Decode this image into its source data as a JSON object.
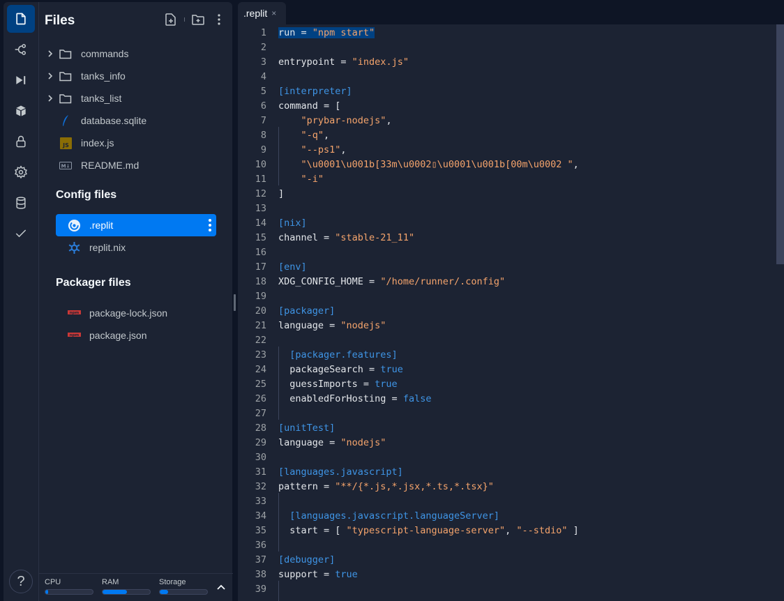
{
  "activity_bar": {
    "items": [
      {
        "name": "files",
        "icon": "file-icon",
        "active": true
      },
      {
        "name": "git",
        "icon": "git-branch-icon"
      },
      {
        "name": "debugger",
        "icon": "step-icon"
      },
      {
        "name": "packages",
        "icon": "package-cube-icon"
      },
      {
        "name": "secrets",
        "icon": "lock-icon"
      },
      {
        "name": "settings",
        "icon": "gear-icon"
      },
      {
        "name": "database",
        "icon": "database-icon"
      },
      {
        "name": "unit-tests",
        "icon": "check-icon"
      }
    ],
    "help_label": "?"
  },
  "sidebar": {
    "title": "Files",
    "actions": [
      "new-file-icon",
      "new-folder-icon",
      "more-options-icon"
    ],
    "tree": [
      {
        "name": "commands",
        "type": "folder"
      },
      {
        "name": "tanks_info",
        "type": "folder"
      },
      {
        "name": "tanks_list",
        "type": "folder"
      },
      {
        "name": "database.sqlite",
        "type": "sqlite"
      },
      {
        "name": "index.js",
        "type": "js"
      },
      {
        "name": "README.md",
        "type": "markdown"
      }
    ],
    "config_section": {
      "title": "Config files",
      "items": [
        {
          "name": ".replit",
          "selected": true
        },
        {
          "name": "replit.nix",
          "selected": false
        }
      ]
    },
    "packager_section": {
      "title": "Packager files",
      "items": [
        {
          "name": "package-lock.json"
        },
        {
          "name": "package.json"
        }
      ]
    },
    "resources": [
      {
        "label": "CPU",
        "usage": 0.04
      },
      {
        "label": "RAM",
        "usage": 0.52
      },
      {
        "label": "Storage",
        "usage": 0.17
      }
    ]
  },
  "editor": {
    "tab": {
      "label": ".replit",
      "close": "×"
    },
    "colors": {
      "string": "#f5a46c",
      "section": "#3f95e6",
      "keyword": "#3f95e6",
      "selection": "#004182"
    },
    "lines": [
      "run = \"npm start\"",
      "",
      "entrypoint = \"index.js\"",
      "",
      "[interpreter]",
      "command = [",
      "    \"prybar-nodejs\",",
      "    \"-q\",",
      "    \"--ps1\",",
      "    \"\\u0001\\u001b[33m\\u0002▯\\u0001\\u001b[00m\\u0002 \",",
      "    \"-i\"",
      "]",
      "",
      "[nix]",
      "channel = \"stable-21_11\"",
      "",
      "[env]",
      "XDG_CONFIG_HOME = \"/home/runner/.config\"",
      "",
      "[packager]",
      "language = \"nodejs\"",
      "",
      "  [packager.features]",
      "  packageSearch = true",
      "  guessImports = true",
      "  enabledForHosting = false",
      "",
      "[unitTest]",
      "language = \"nodejs\"",
      "",
      "[languages.javascript]",
      "pattern = \"**/{*.js,*.jsx,*.ts,*.tsx}\"",
      "",
      "  [languages.javascript.languageServer]",
      "  start = [ \"typescript-language-server\", \"--stdio\" ]",
      "",
      "[debugger]",
      "support = true",
      ""
    ]
  }
}
